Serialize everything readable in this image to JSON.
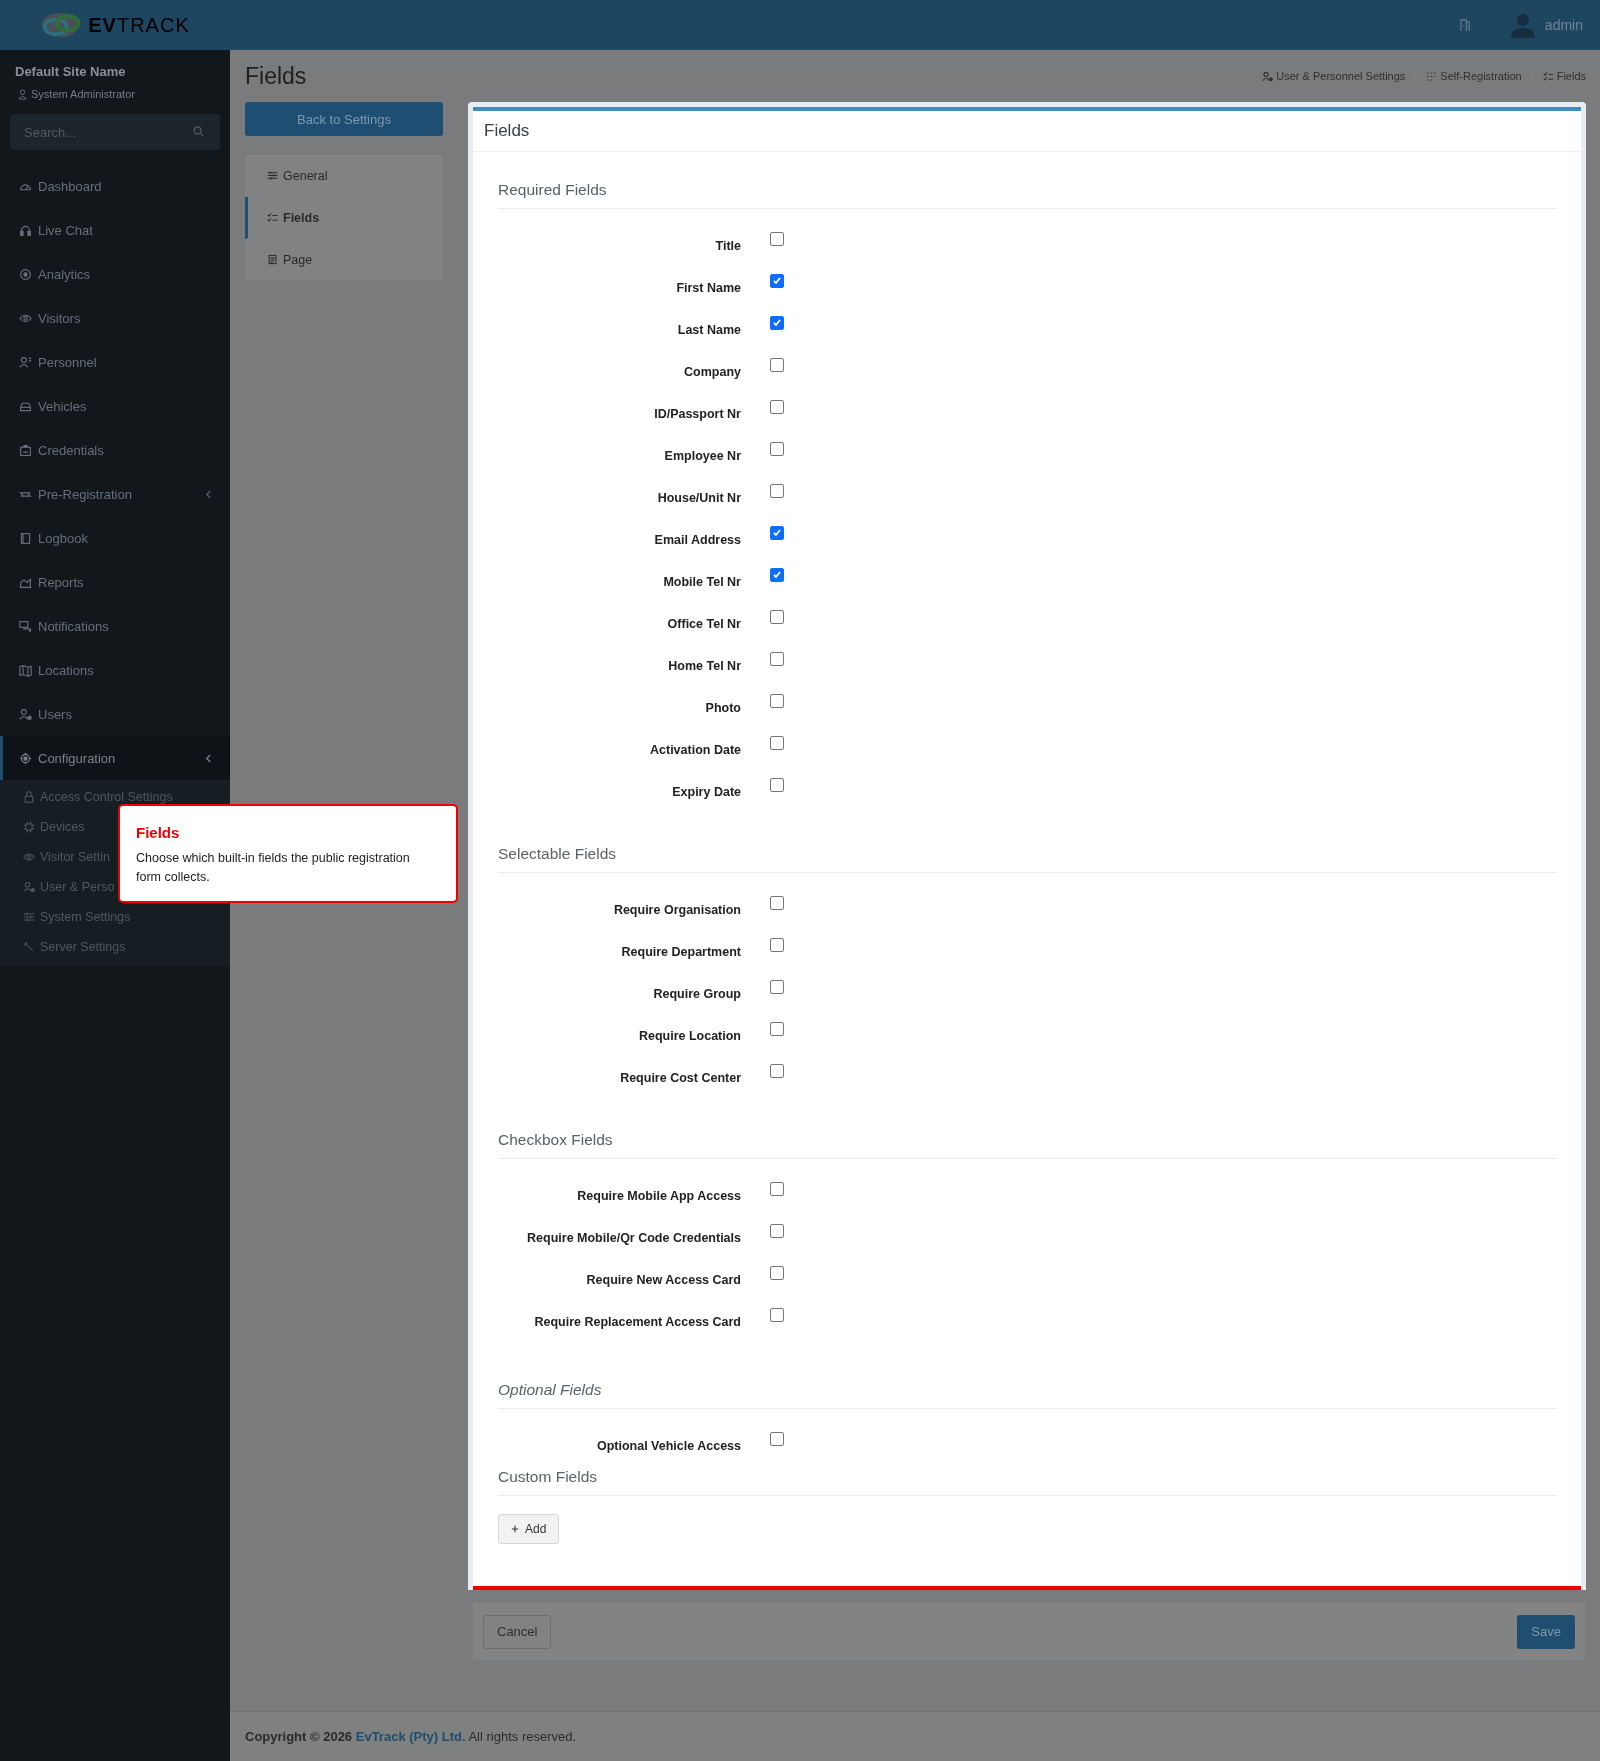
{
  "header": {
    "logo": "**EV**TRACK",
    "user": "admin"
  },
  "sidebar": {
    "site_name": "Default Site Name",
    "role": "System Administrator",
    "search": {
      "placeholder": "Search..."
    },
    "items": [
      {
        "label": "Dashboard",
        "selected": false
      },
      {
        "label": "Live Chat",
        "selected": false
      },
      {
        "label": "Analytics",
        "selected": false
      },
      {
        "label": "Visitors",
        "selected": false
      },
      {
        "label": "Personnel",
        "selected": false
      },
      {
        "label": "Vehicles",
        "selected": false
      },
      {
        "label": "Credentials",
        "selected": false
      },
      {
        "label": "Pre-Registration",
        "selected": false,
        "expanded": false
      },
      {
        "label": "Logbook",
        "selected": false
      },
      {
        "label": "Reports",
        "selected": false
      },
      {
        "label": "Notifications",
        "selected": false
      },
      {
        "label": "Locations",
        "selected": false
      },
      {
        "label": "Users",
        "selected": false
      },
      {
        "label": "Configuration",
        "selected": true,
        "expanded": true,
        "children": [
          {
            "label": "Access Control Settings"
          },
          {
            "label": "Devices"
          },
          {
            "label": "Visitor Settin"
          },
          {
            "label": "User & Perso"
          },
          {
            "label": "System Settings"
          },
          {
            "label": "Server Settings"
          }
        ]
      }
    ]
  },
  "page": {
    "title": "Fields",
    "breadcrumb": [
      "User & Personnel Settings",
      "Self-Registration",
      "Fields"
    ],
    "back_button": "Back to Settings",
    "subnav": [
      {
        "label": "General",
        "selected": false
      },
      {
        "label": "Fields",
        "selected": true
      },
      {
        "label": "Page",
        "selected": false
      }
    ]
  },
  "card": {
    "title": "Fields",
    "sections": [
      {
        "title": "Required Fields",
        "emphasis": false,
        "fields": [
          {
            "label": "Title",
            "checked": false
          },
          {
            "label": "First Name",
            "checked": true
          },
          {
            "label": "Last Name",
            "checked": true
          },
          {
            "label": "Company",
            "checked": false
          },
          {
            "label": "ID/Passport Nr",
            "checked": false
          },
          {
            "label": "Employee Nr",
            "checked": false
          },
          {
            "label": "House/Unit Nr",
            "checked": false
          },
          {
            "label": "Email Address",
            "checked": true
          },
          {
            "label": "Mobile Tel Nr",
            "checked": true
          },
          {
            "label": "Office Tel Nr",
            "checked": false
          },
          {
            "label": "Home Tel Nr",
            "checked": false
          },
          {
            "label": "Photo",
            "checked": false
          },
          {
            "label": "Activation Date",
            "checked": false
          },
          {
            "label": "Expiry Date",
            "checked": false
          }
        ]
      },
      {
        "title": "Selectable Fields",
        "emphasis": false,
        "fields": [
          {
            "label": "Require Organisation",
            "checked": false
          },
          {
            "label": "Require Department",
            "checked": false
          },
          {
            "label": "Require Group",
            "checked": false
          },
          {
            "label": "Require Location",
            "checked": false
          },
          {
            "label": "Require Cost Center",
            "checked": false
          }
        ]
      },
      {
        "title": "Checkbox Fields",
        "emphasis": false,
        "fields": [
          {
            "label": "Require Mobile App Access",
            "checked": false
          },
          {
            "label": "Require Mobile/Qr Code Credentials",
            "checked": false
          },
          {
            "label": "Require New Access Card",
            "checked": false
          },
          {
            "label": "Require Replacement Access Card",
            "checked": false
          }
        ]
      },
      {
        "title": "Optional Fields",
        "emphasis": true,
        "fields": [
          {
            "label": "Optional Vehicle Access",
            "checked": false
          }
        ]
      },
      {
        "title": "Custom Fields",
        "emphasis": false,
        "add_button": "Add"
      }
    ]
  },
  "actions": {
    "cancel": "Cancel",
    "save": "Save"
  },
  "tour": {
    "title": "Fields",
    "text": "Choose which built-in fields the public registration form collects."
  },
  "footer": {
    "prefix": "Copyright © 2026",
    "link": "EvTrack (Pty) Ltd.",
    "suffix": "All rights reserved."
  }
}
